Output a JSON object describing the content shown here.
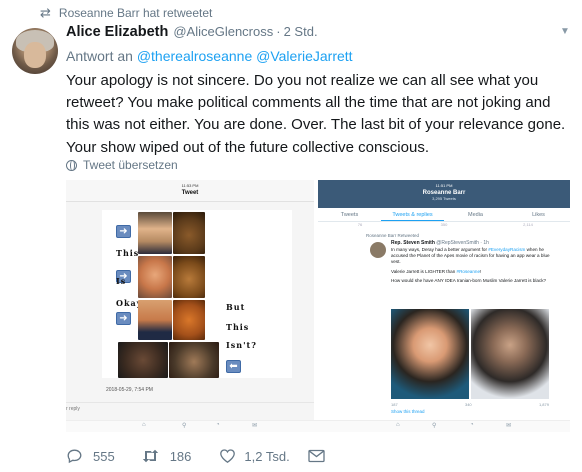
{
  "retweet_context": "Roseanne Barr hat retweetet",
  "author": {
    "name": "Alice Elizabeth",
    "handle": "@AliceGlencross",
    "separator": "·",
    "time": "2 Std."
  },
  "reply_to": {
    "prefix": "Antwort an",
    "mentions": [
      "@therealroseanne",
      "@ValerieJarrett"
    ]
  },
  "tweet_text": "Your apology is not sincere. Do you not realize we can all see what you retweet? You make political comments all the time that are not joking and this was not either. You are done. Over. The last bit of your relevance gone. Your show wiped out of the future collective conscious.",
  "translate_label": "Tweet übersetzen",
  "left_image": {
    "status_time": "11:53 PM",
    "title": "Tweet",
    "meme_text": [
      "This",
      "Is",
      "Okay",
      "But",
      "This",
      "Isn't?"
    ],
    "date": "2018-05-29, 7:54 PM",
    "reply_hint": "r reply"
  },
  "right_image": {
    "status_time": "11:51 PM",
    "profile_name": "Roseanne Barr",
    "profile_count": "3,295 Tweets",
    "tabs": [
      "Tweets",
      "Tweets & replies",
      "Media",
      "Likes"
    ],
    "active_tab": "Tweets & replies",
    "counts": [
      "76",
      "350",
      "2,114"
    ],
    "retweeted_label": "Roseanne Barr Retweeted",
    "rt_author_name": "Rep. Steven Smith",
    "rt_author_handle": "@RepStevenSmith · 1h",
    "rt_text_1": "In many ways, Deray had a better argument for",
    "rt_hashtag_1": "#EverydayRacism",
    "rt_text_2": "when he accused the Planet of the Apes movie of racism for having an app wear a blue vest.",
    "rt_text_3": "Valerie Jarrett is LIGHTER than",
    "rt_hashtag_2": "#Roseanne",
    "rt_text_3_end": "!",
    "rt_text_4": "How would she have ANY IDEA Iranian-born Muslim Valerie Jarrett is black?",
    "action_counts": [
      "187",
      "340",
      "1,879"
    ],
    "show_thread": "Show this thread"
  },
  "actions": {
    "replies": "555",
    "retweets": "186",
    "likes": "1,2 Tsd."
  },
  "colors": {
    "accent": "#1da1f2",
    "secondary_text": "#657786",
    "primary_text": "#14171a"
  }
}
